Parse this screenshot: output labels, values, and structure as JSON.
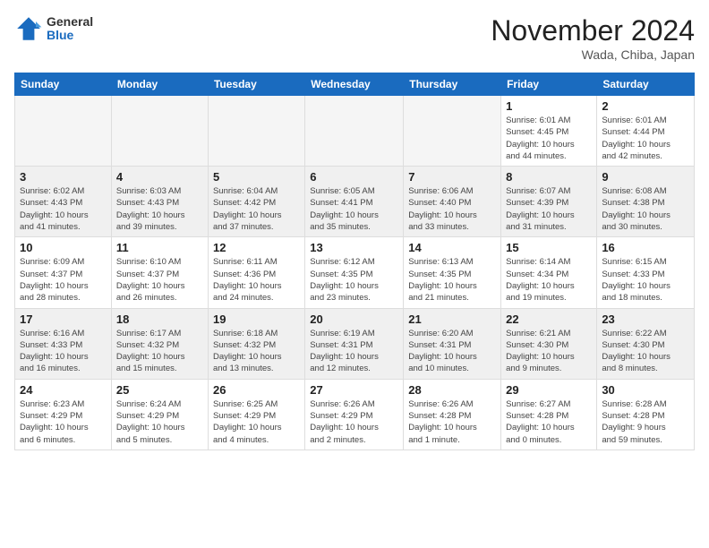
{
  "logo": {
    "general": "General",
    "blue": "Blue"
  },
  "header": {
    "month": "November 2024",
    "location": "Wada, Chiba, Japan"
  },
  "weekdays": [
    "Sunday",
    "Monday",
    "Tuesday",
    "Wednesday",
    "Thursday",
    "Friday",
    "Saturday"
  ],
  "rows": [
    {
      "days": [
        {
          "num": "",
          "info": ""
        },
        {
          "num": "",
          "info": ""
        },
        {
          "num": "",
          "info": ""
        },
        {
          "num": "",
          "info": ""
        },
        {
          "num": "",
          "info": ""
        },
        {
          "num": "1",
          "info": "Sunrise: 6:01 AM\nSunset: 4:45 PM\nDaylight: 10 hours\nand 44 minutes."
        },
        {
          "num": "2",
          "info": "Sunrise: 6:01 AM\nSunset: 4:44 PM\nDaylight: 10 hours\nand 42 minutes."
        }
      ]
    },
    {
      "days": [
        {
          "num": "3",
          "info": "Sunrise: 6:02 AM\nSunset: 4:43 PM\nDaylight: 10 hours\nand 41 minutes."
        },
        {
          "num": "4",
          "info": "Sunrise: 6:03 AM\nSunset: 4:43 PM\nDaylight: 10 hours\nand 39 minutes."
        },
        {
          "num": "5",
          "info": "Sunrise: 6:04 AM\nSunset: 4:42 PM\nDaylight: 10 hours\nand 37 minutes."
        },
        {
          "num": "6",
          "info": "Sunrise: 6:05 AM\nSunset: 4:41 PM\nDaylight: 10 hours\nand 35 minutes."
        },
        {
          "num": "7",
          "info": "Sunrise: 6:06 AM\nSunset: 4:40 PM\nDaylight: 10 hours\nand 33 minutes."
        },
        {
          "num": "8",
          "info": "Sunrise: 6:07 AM\nSunset: 4:39 PM\nDaylight: 10 hours\nand 31 minutes."
        },
        {
          "num": "9",
          "info": "Sunrise: 6:08 AM\nSunset: 4:38 PM\nDaylight: 10 hours\nand 30 minutes."
        }
      ]
    },
    {
      "days": [
        {
          "num": "10",
          "info": "Sunrise: 6:09 AM\nSunset: 4:37 PM\nDaylight: 10 hours\nand 28 minutes."
        },
        {
          "num": "11",
          "info": "Sunrise: 6:10 AM\nSunset: 4:37 PM\nDaylight: 10 hours\nand 26 minutes."
        },
        {
          "num": "12",
          "info": "Sunrise: 6:11 AM\nSunset: 4:36 PM\nDaylight: 10 hours\nand 24 minutes."
        },
        {
          "num": "13",
          "info": "Sunrise: 6:12 AM\nSunset: 4:35 PM\nDaylight: 10 hours\nand 23 minutes."
        },
        {
          "num": "14",
          "info": "Sunrise: 6:13 AM\nSunset: 4:35 PM\nDaylight: 10 hours\nand 21 minutes."
        },
        {
          "num": "15",
          "info": "Sunrise: 6:14 AM\nSunset: 4:34 PM\nDaylight: 10 hours\nand 19 minutes."
        },
        {
          "num": "16",
          "info": "Sunrise: 6:15 AM\nSunset: 4:33 PM\nDaylight: 10 hours\nand 18 minutes."
        }
      ]
    },
    {
      "days": [
        {
          "num": "17",
          "info": "Sunrise: 6:16 AM\nSunset: 4:33 PM\nDaylight: 10 hours\nand 16 minutes."
        },
        {
          "num": "18",
          "info": "Sunrise: 6:17 AM\nSunset: 4:32 PM\nDaylight: 10 hours\nand 15 minutes."
        },
        {
          "num": "19",
          "info": "Sunrise: 6:18 AM\nSunset: 4:32 PM\nDaylight: 10 hours\nand 13 minutes."
        },
        {
          "num": "20",
          "info": "Sunrise: 6:19 AM\nSunset: 4:31 PM\nDaylight: 10 hours\nand 12 minutes."
        },
        {
          "num": "21",
          "info": "Sunrise: 6:20 AM\nSunset: 4:31 PM\nDaylight: 10 hours\nand 10 minutes."
        },
        {
          "num": "22",
          "info": "Sunrise: 6:21 AM\nSunset: 4:30 PM\nDaylight: 10 hours\nand 9 minutes."
        },
        {
          "num": "23",
          "info": "Sunrise: 6:22 AM\nSunset: 4:30 PM\nDaylight: 10 hours\nand 8 minutes."
        }
      ]
    },
    {
      "days": [
        {
          "num": "24",
          "info": "Sunrise: 6:23 AM\nSunset: 4:29 PM\nDaylight: 10 hours\nand 6 minutes."
        },
        {
          "num": "25",
          "info": "Sunrise: 6:24 AM\nSunset: 4:29 PM\nDaylight: 10 hours\nand 5 minutes."
        },
        {
          "num": "26",
          "info": "Sunrise: 6:25 AM\nSunset: 4:29 PM\nDaylight: 10 hours\nand 4 minutes."
        },
        {
          "num": "27",
          "info": "Sunrise: 6:26 AM\nSunset: 4:29 PM\nDaylight: 10 hours\nand 2 minutes."
        },
        {
          "num": "28",
          "info": "Sunrise: 6:26 AM\nSunset: 4:28 PM\nDaylight: 10 hours\nand 1 minute."
        },
        {
          "num": "29",
          "info": "Sunrise: 6:27 AM\nSunset: 4:28 PM\nDaylight: 10 hours\nand 0 minutes."
        },
        {
          "num": "30",
          "info": "Sunrise: 6:28 AM\nSunset: 4:28 PM\nDaylight: 9 hours\nand 59 minutes."
        }
      ]
    }
  ]
}
